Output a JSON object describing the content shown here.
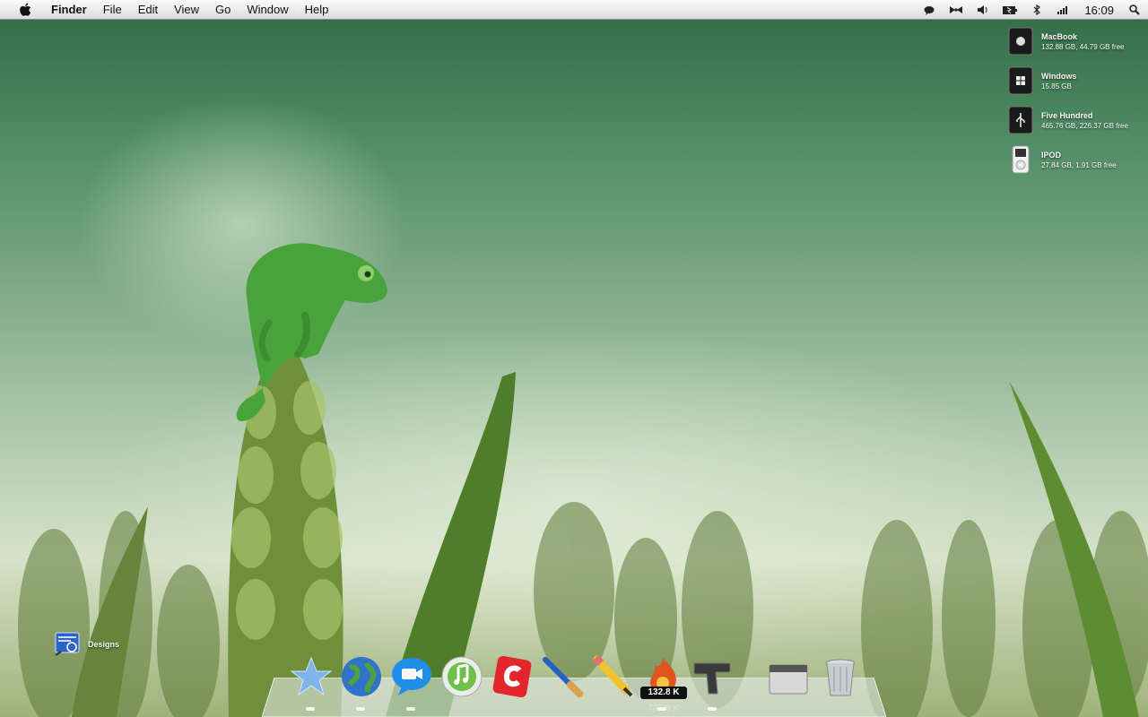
{
  "menubar": {
    "app_name": "Finder",
    "items": [
      "File",
      "Edit",
      "View",
      "Go",
      "Window",
      "Help"
    ],
    "clock": "16:09",
    "status_icons": [
      "chat-icon",
      "bow-tie-icon",
      "volume-icon",
      "battery-icon",
      "bluetooth-icon",
      "wifi-icon",
      "spotlight-icon"
    ]
  },
  "drives": [
    {
      "name": "MacBook",
      "info": "132.88 GB, 44.79 GB free",
      "icon": "apple-drive-icon"
    },
    {
      "name": "Windows",
      "info": "15.85 GB",
      "icon": "windows-drive-icon"
    },
    {
      "name": "Five Hundred",
      "info": "465.76 GB, 226.37 GB free",
      "icon": "usb-drive-icon"
    },
    {
      "name": "IPOD",
      "info": "27.84 GB, 1.91 GB free",
      "icon": "ipod-icon"
    }
  ],
  "desktop_icon": {
    "label": "Designs",
    "icon": "designs-folder-icon"
  },
  "dock": {
    "items": [
      "finder-star-icon",
      "network-globe-icon",
      "ichat-video-icon",
      "itunes-icon",
      "cssedit-icon",
      "paintbrush-icon",
      "pencil-icon",
      "activity-flame-icon",
      "gun-icon",
      "scanner-icon",
      "trash-icon"
    ],
    "badge": "132.8 K",
    "colors": {
      "accent": "#4a9d3c",
      "shelf": "#e7eef0"
    }
  }
}
